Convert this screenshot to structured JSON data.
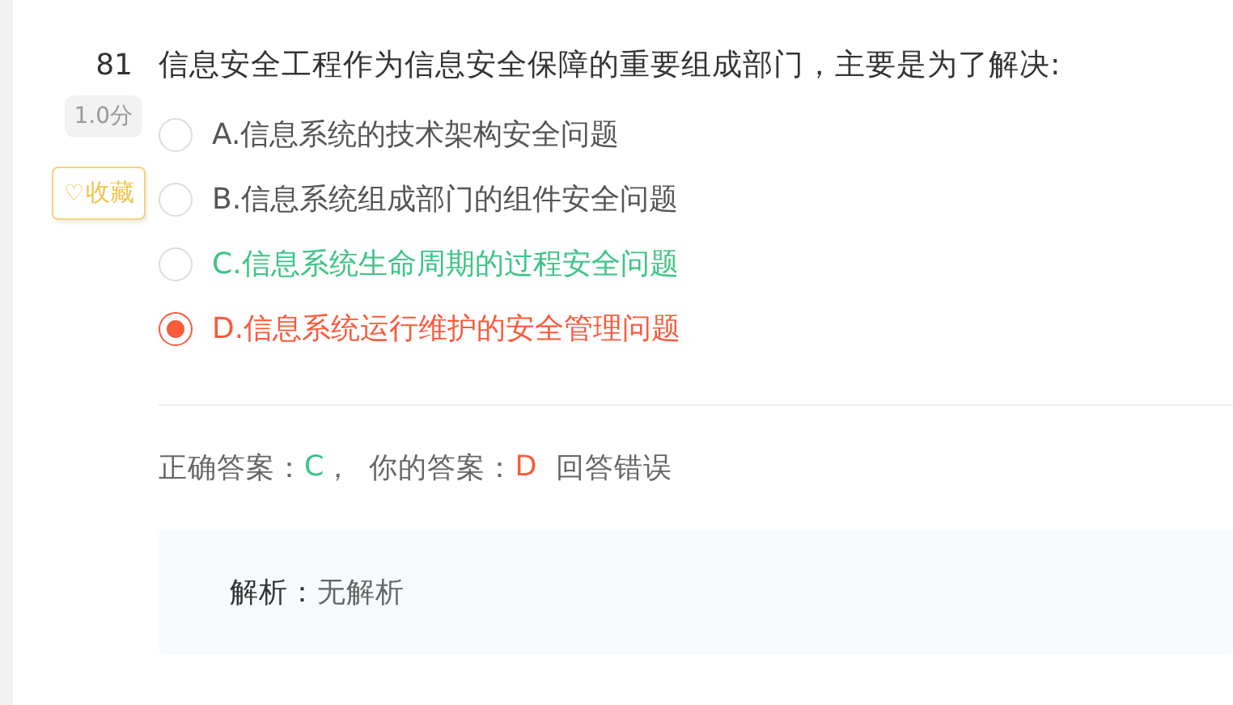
{
  "question": {
    "number": "81",
    "score": "1.0分",
    "favorite": {
      "icon": "♡",
      "label": "收藏"
    },
    "text": "信息安全工程作为信息安全保障的重要组成部门，主要是为了解决:"
  },
  "options": [
    {
      "label": "A.信息系统的技术架构安全问题",
      "selected": false,
      "kind": "normal"
    },
    {
      "label": "B.信息系统组成部门的组件安全问题",
      "selected": false,
      "kind": "normal"
    },
    {
      "label": "C.信息系统生命周期的过程安全问题",
      "selected": false,
      "kind": "correct"
    },
    {
      "label": "D.信息系统运行维护的安全管理问题",
      "selected": true,
      "kind": "wrong"
    }
  ],
  "result": {
    "correct_label": "正确答案：",
    "correct_value": "C",
    "separator": "，",
    "your_label": "你的答案：",
    "your_value": "D",
    "verdict": "回答错误"
  },
  "analysis": {
    "label": "解析：",
    "text": "无解析"
  }
}
